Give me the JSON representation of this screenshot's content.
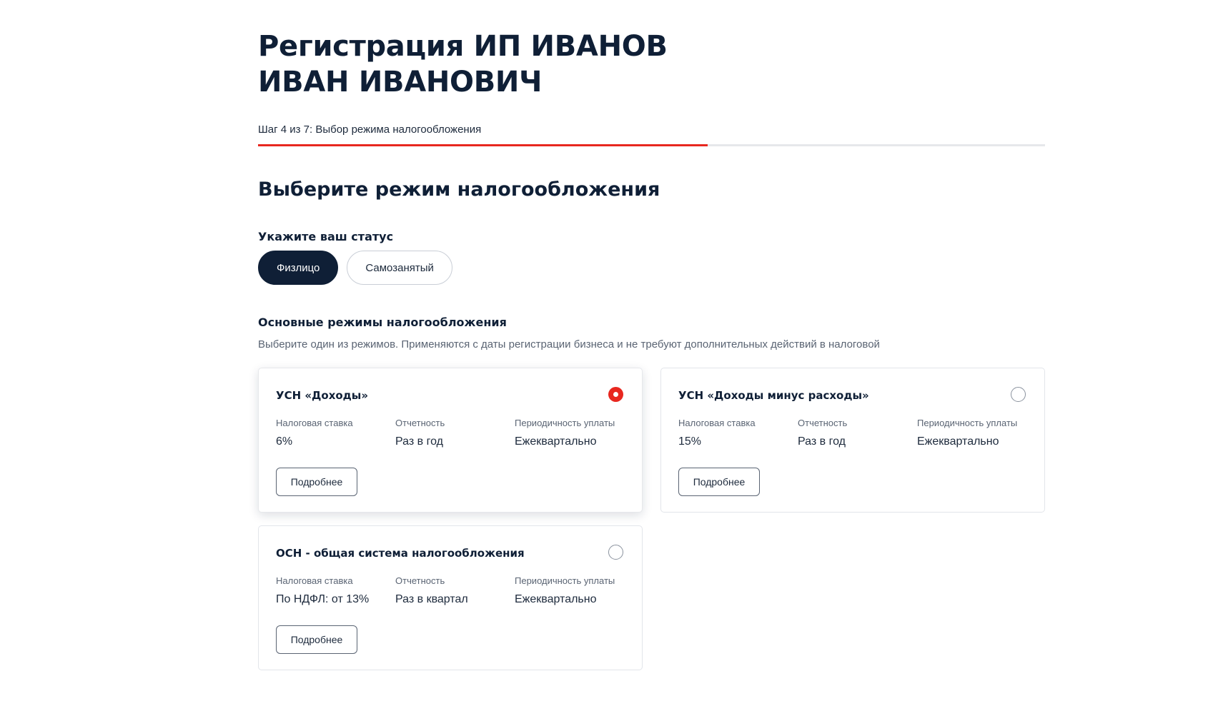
{
  "page": {
    "title": "Регистрация ИП ИВАНОВ ИВАН ИВАНОВИЧ",
    "step_label": "Шаг 4 из 7: Выбор режима налогообложения",
    "progress": {
      "current": 4,
      "total": 7,
      "fraction": 0.571,
      "fill_color": "#e8271f"
    }
  },
  "section_title": "Выберите режим налогообложения",
  "status": {
    "label": "Укажите ваш статус",
    "options": [
      {
        "label": "Физлицо",
        "selected": true
      },
      {
        "label": "Самозанятый",
        "selected": false
      }
    ]
  },
  "modes": {
    "title": "Основные режимы налогообложения",
    "description": "Выберите один из режимов. Применяются с даты регистрации бизнеса и не требуют дополнительных действий в налоговой",
    "cards": [
      {
        "title": "УСН «Доходы»",
        "selected": true,
        "attrs": [
          {
            "label": "Налоговая ставка",
            "value": "6%"
          },
          {
            "label": "Отчетность",
            "value": "Раз в год"
          },
          {
            "label": "Периодичность уплаты",
            "value": "Ежеквартально"
          }
        ],
        "button_label": "Подробнее"
      },
      {
        "title": "УСН «Доходы минус расходы»",
        "selected": false,
        "attrs": [
          {
            "label": "Налоговая ставка",
            "value": "15%"
          },
          {
            "label": "Отчетность",
            "value": "Раз в год"
          },
          {
            "label": "Периодичность уплаты",
            "value": "Ежеквартально"
          }
        ],
        "button_label": "Подробнее"
      },
      {
        "title": "ОСН - общая система налогообложения",
        "selected": false,
        "attrs": [
          {
            "label": "Налоговая ставка",
            "value": "По НДФЛ: от 13%"
          },
          {
            "label": "Отчетность",
            "value": "Раз в квартал"
          },
          {
            "label": "Периодичность уплаты",
            "value": "Ежеквартально"
          }
        ],
        "button_label": "Подробнее"
      }
    ]
  },
  "colors": {
    "primary_dark": "#0f1f36",
    "accent_red": "#e8271f",
    "muted_text": "#5a6473"
  }
}
